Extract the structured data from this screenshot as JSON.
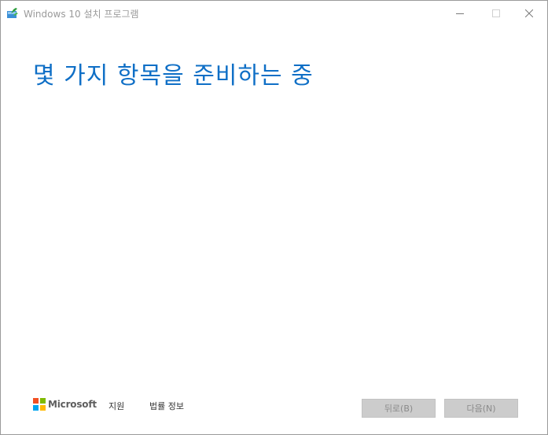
{
  "window": {
    "title": "Windows 10 설치 프로그램"
  },
  "main": {
    "heading": "몇 가지 항목을 준비하는 중"
  },
  "footer": {
    "brand": "Microsoft",
    "support_link": "지원",
    "legal_link": "법률 정보",
    "back_button": "뒤로(B)",
    "next_button": "다음(N)"
  },
  "colors": {
    "heading": "#0f6fc6",
    "button_bg_disabled": "#cccccc",
    "ms_red": "#f25022",
    "ms_green": "#7fba00",
    "ms_blue": "#00a4ef",
    "ms_yellow": "#ffb900"
  },
  "icons": {
    "app": "setup-app-icon",
    "minimize": "minimize-icon",
    "maximize": "maximize-icon",
    "close": "close-icon"
  }
}
